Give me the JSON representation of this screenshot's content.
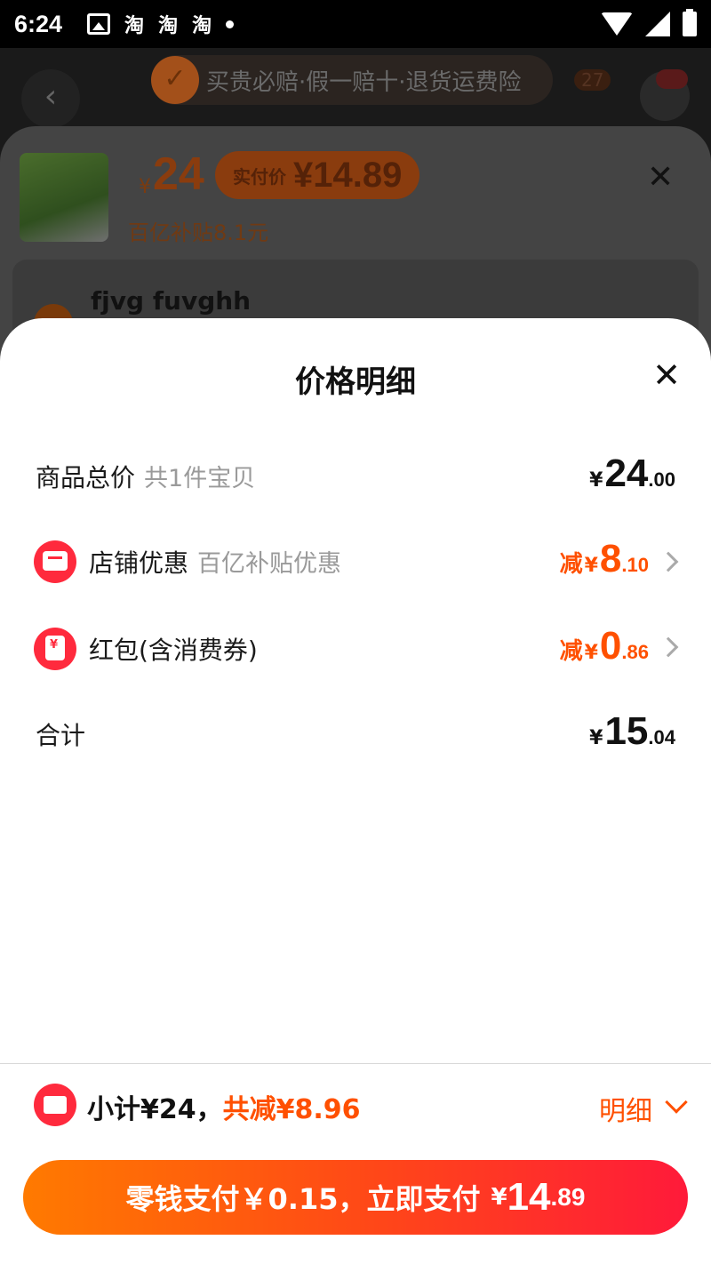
{
  "status_bar": {
    "time": "6:24",
    "notification_icons": [
      "淘",
      "淘",
      "淘"
    ]
  },
  "background_page": {
    "banner_text": "买贵必赔·假一赔十·退货运费险",
    "cart_count": "27",
    "sku": {
      "currency": "¥",
      "price": "24",
      "actual_label": "实付价",
      "actual_price": "¥14.89",
      "subsidy_text": "百亿补贴8.1元",
      "address_name": "fjvg fuvghh"
    }
  },
  "sheet": {
    "title": "价格明细",
    "rows": [
      {
        "label": "商品总价",
        "sub": "共1件宝贝",
        "prefix": "",
        "currency": "¥",
        "int": "24",
        "dec": ".00"
      },
      {
        "label": "店铺优惠",
        "sub": "百亿补贴优惠",
        "prefix": "减",
        "currency": "¥",
        "int": "8",
        "dec": ".10"
      },
      {
        "label": "红包(含消费券)",
        "sub": "",
        "prefix": "减",
        "currency": "¥",
        "int": "0",
        "dec": ".86"
      },
      {
        "label": "合计",
        "sub": "",
        "prefix": "",
        "currency": "¥",
        "int": "15",
        "dec": ".04"
      }
    ]
  },
  "bottom_bar": {
    "subtotal": "小计¥24，",
    "reduce": "共减¥8.96",
    "detail_link": "明细",
    "pay_button": {
      "text": "零钱支付￥0.15，立即支付",
      "currency": "¥",
      "int": "14",
      "dec": ".89"
    }
  },
  "colors": {
    "accent": "#ff5000",
    "red": "#ff2a3d"
  }
}
